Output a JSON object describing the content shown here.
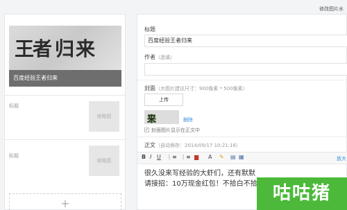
{
  "header": {
    "modify_link": "修改图片水"
  },
  "article_list": {
    "cover_title": "百度经验王者归来",
    "cover_brush": {
      "part1": "王者",
      "part2": "归",
      "part3": "来"
    },
    "sub_items": [
      {
        "label": "标题",
        "thumb": "缩略图"
      },
      {
        "label": "标题",
        "thumb": "缩略图"
      }
    ],
    "add_symbol": "+"
  },
  "editor": {
    "title_label": "标题",
    "title_value": "百度经验王者归来",
    "author_label": "作者",
    "author_hint": "（选填）",
    "cover_label": "封面",
    "cover_hint": "（大图片建议尺寸：900像素 * 500像素）",
    "upload_label": "上传",
    "delete_label": "删除",
    "show_cover_label": "封面图片显示在正文中",
    "body_label": "正文",
    "autosave_hint": "（自动保存：2014/09/17 10:21:16）",
    "enlarge_label": "放大",
    "body_lines": [
      "很久没来写经验的大虾们，还有默默",
      "请接招：10万现金红包！不拾白不拾"
    ]
  },
  "toolbar": {
    "bold": "B",
    "italic": "I",
    "underline": "U",
    "list_bullet": "⋮≡",
    "list_number": "⋮≡",
    "image": "▆",
    "font_color": "A",
    "highlight": "✎",
    "table": "▤",
    "code": "▦"
  },
  "watermark": {
    "text": "咕咕猪"
  },
  "colors": {
    "accent_link": "#3a8ee6",
    "brand_green": "#4cb93a",
    "brush_green": "#6cc33a"
  }
}
